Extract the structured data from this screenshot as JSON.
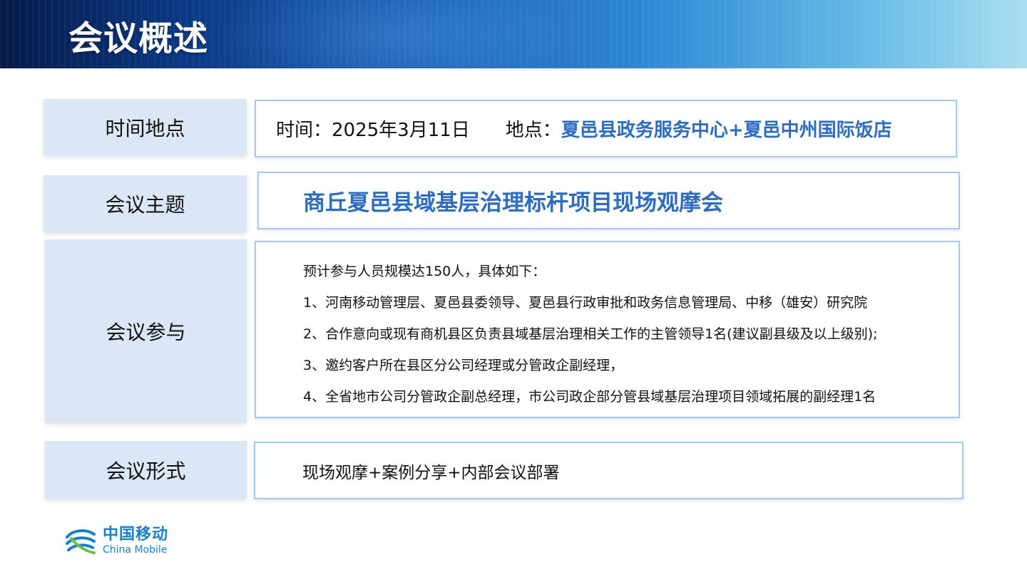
{
  "header": {
    "title": "会议概述"
  },
  "rows": {
    "time_place": {
      "label": "时间地点",
      "time_text": "时间：2025年3月11日",
      "place_label": "地点：",
      "place_value": "夏邑县政务服务中心+夏邑中州国际饭店"
    },
    "theme": {
      "label": "会议主题",
      "text": "商丘夏邑县域基层治理标杆项目现场观摩会"
    },
    "attendance": {
      "label": "会议参与",
      "items": [
        "预计参与人员规模达150人，具体如下：",
        "1、河南移动管理层、夏邑县委领导、夏邑县行政审批和政务信息管理局、中移（雄安）研究院",
        "2、合作意向或现有商机县区负责县域基层治理相关工作的主管领导1名(建议副县级及以上级别);",
        "3、邀约客户所在县区分公司经理或分管政企副经理，",
        "4、全省地市公司分管政企副总经理，市公司政企部分管县域基层治理项目领域拓展的副经理1名"
      ]
    },
    "format": {
      "label": "会议形式",
      "text": "现场观摩+案例分享+内部会议部署"
    }
  },
  "logo": {
    "cn": "中国移动",
    "en": "China Mobile"
  },
  "colors": {
    "accent": "#2e6cc0",
    "label_bg": "#dbe6f6",
    "border": "#a9c6ec",
    "logo": "#1a7fc4"
  }
}
